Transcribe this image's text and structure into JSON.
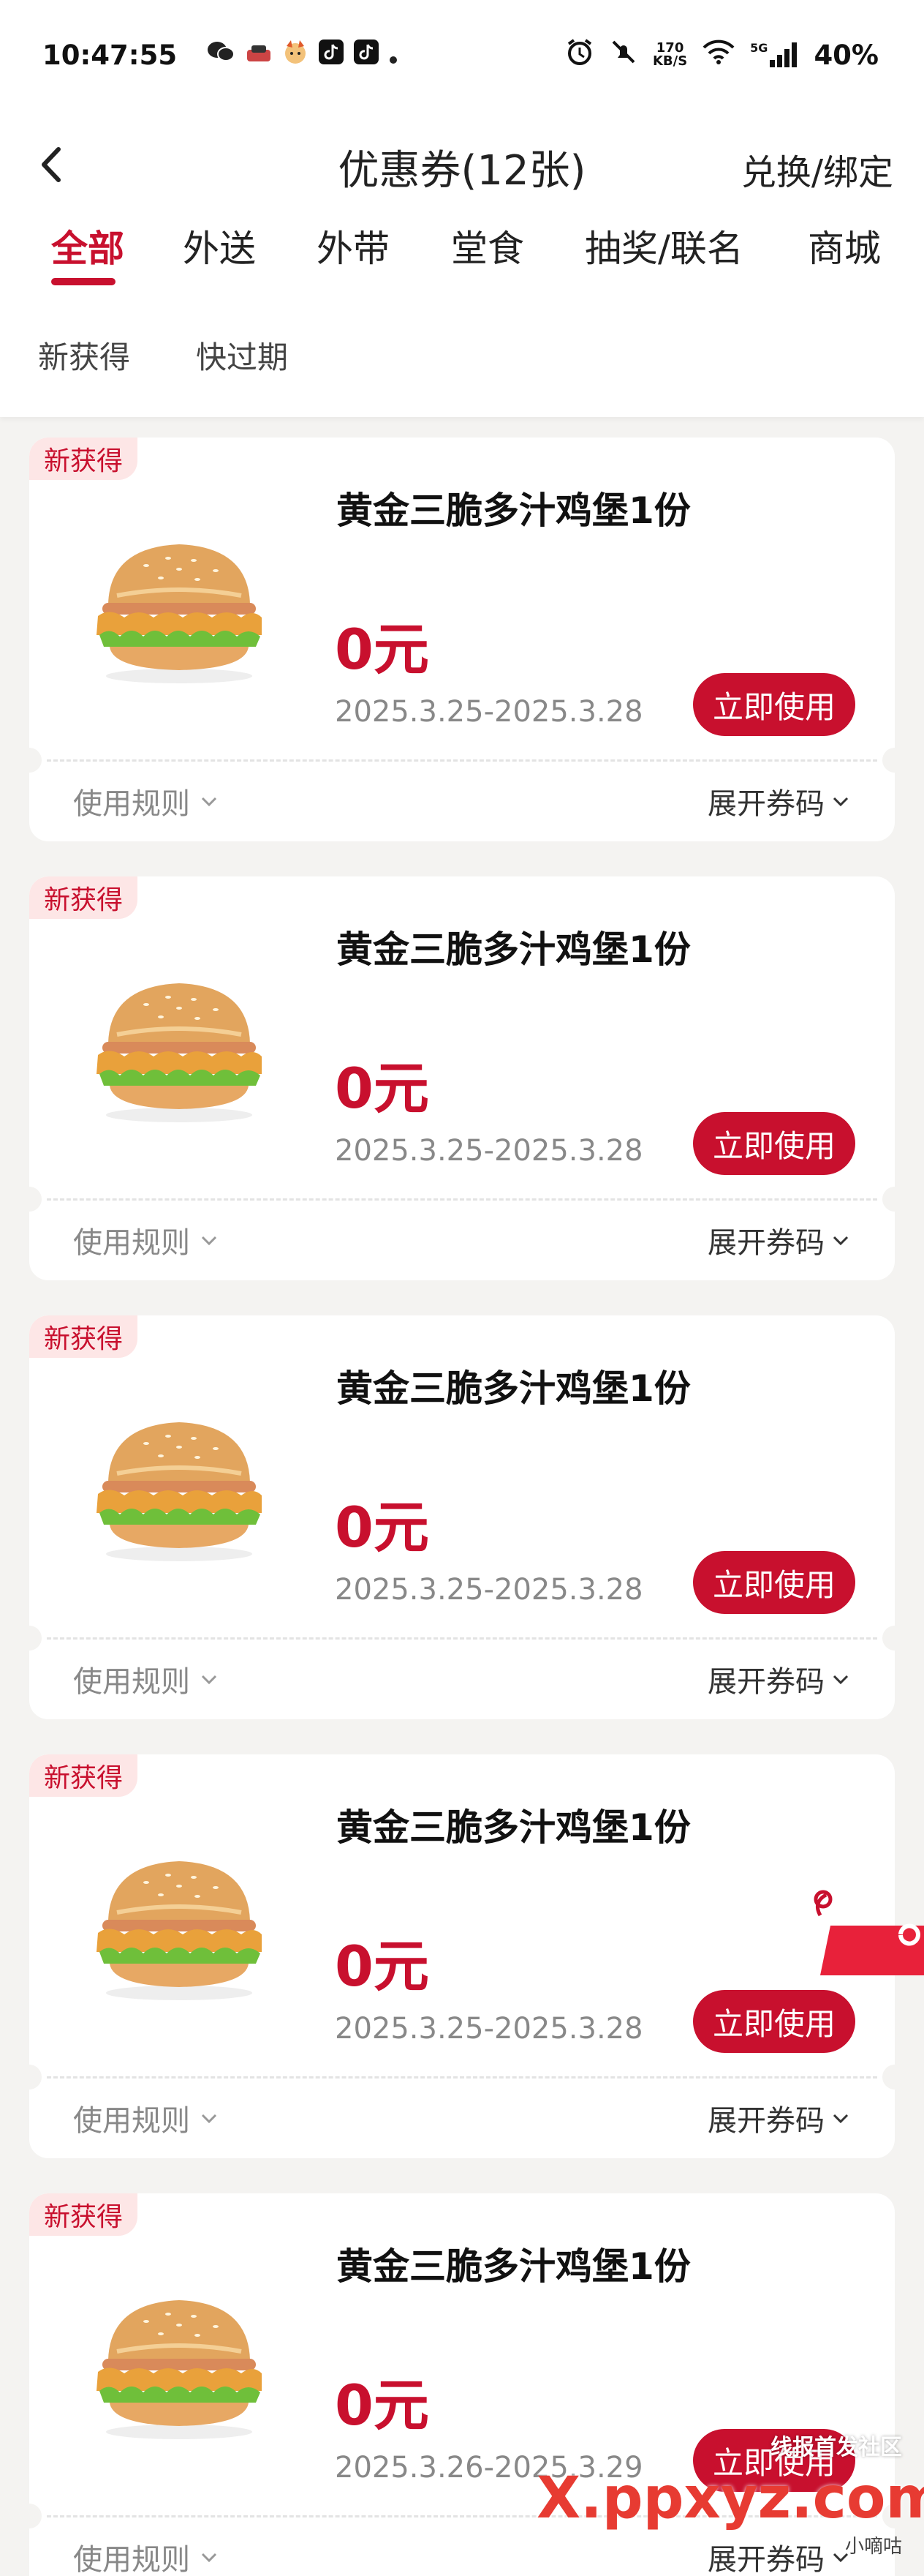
{
  "status_bar": {
    "time": "10:47:55",
    "network_speed": "170",
    "network_unit": "KB/S",
    "signal_gen": "5G",
    "battery": "40%"
  },
  "header": {
    "title": "优惠券(12张)",
    "right_link": "兑换/绑定",
    "tabs": [
      {
        "label": "全部",
        "active": true
      },
      {
        "label": "外送",
        "active": false
      },
      {
        "label": "外带",
        "active": false
      },
      {
        "label": "堂食",
        "active": false
      },
      {
        "label": "抽奖/联名",
        "active": false
      },
      {
        "label": "商城",
        "active": false
      }
    ],
    "filters": [
      "新获得",
      "快过期"
    ]
  },
  "coupons": [
    {
      "badge": "新获得",
      "title": "黄金三脆多汁鸡堡1份",
      "price": "0元",
      "validity": "2025.3.25-2025.3.28",
      "button": "立即使用",
      "rules": "使用规则",
      "expand": "展开券码"
    },
    {
      "badge": "新获得",
      "title": "黄金三脆多汁鸡堡1份",
      "price": "0元",
      "validity": "2025.3.25-2025.3.28",
      "button": "立即使用",
      "rules": "使用规则",
      "expand": "展开券码"
    },
    {
      "badge": "新获得",
      "title": "黄金三脆多汁鸡堡1份",
      "price": "0元",
      "validity": "2025.3.25-2025.3.28",
      "button": "立即使用",
      "rules": "使用规则",
      "expand": "展开券码"
    },
    {
      "badge": "新获得",
      "title": "黄金三脆多汁鸡堡1份",
      "price": "0元",
      "validity": "2025.3.25-2025.3.28",
      "button": "立即使用",
      "rules": "使用规则",
      "expand": "展开券码"
    },
    {
      "badge": "新获得",
      "title": "黄金三脆多汁鸡堡1份",
      "price": "0元",
      "validity": "2025.3.26-2025.3.29",
      "button": "立即使用",
      "rules": "使用规则",
      "expand": "展开券码"
    }
  ],
  "watermark": {
    "top_text": "线报首发社区",
    "main_text": "X.ppxyz.com",
    "sub_text": "小嘀咕"
  },
  "colors": {
    "brand_red": "#c8102e",
    "badge_bg": "#fde6e6",
    "page_bg": "#f4f3f1"
  }
}
